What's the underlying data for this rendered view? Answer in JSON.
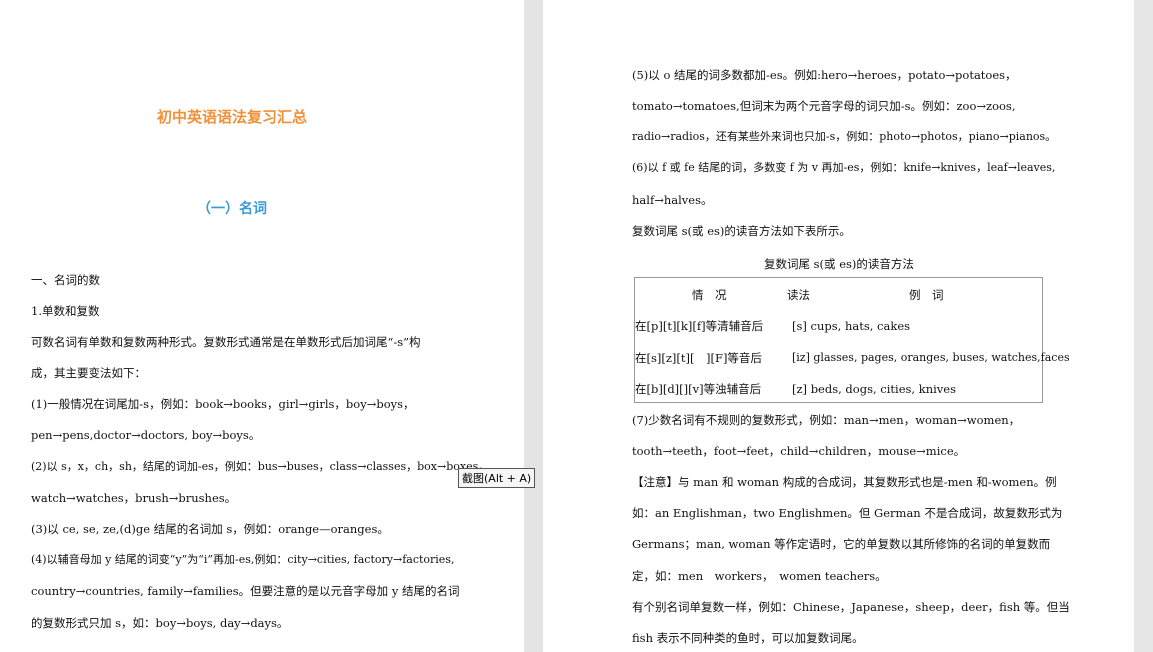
{
  "left_page": {
    "doc_title": "初中英语语法复习汇总",
    "section_title": "（一）名词",
    "lines": [
      "一、名词的数",
      "1.单数和复数",
      "可数名词有单数和复数两种形式。复数形式通常是在单数形式后加词尾“-s”构",
      "成，其主要变法如下：",
      "(1)一般情况在词尾加-s，例如：book→books，girl→girls，boy→boys，",
      "pen→pens,doctor→doctors, boy→boys。",
      "(2)以 s，x，ch，sh，结尾的词加-es，例如：bus→buses，class→classes，box→boxes，",
      "watch→watches，brush→brushes。",
      "(3)以 ce, se, ze,(d)ge 结尾的名词加 s，例如：orange—oranges。",
      "(4)以辅音母加 y 结尾的词变“y”为“i”再加-es,例如：city→cities, factory→factories,",
      "country→countries, family→families。但要注意的是以元音字母加 y 结尾的名词",
      "的复数形式只加 s，如：boy→boys, day→days。"
    ]
  },
  "right_page": {
    "lines_top": [
      "(5)以 o 结尾的词多数都加-es。例如:hero→heroes，potato→potatoes，",
      "tomato→tomatoes,但词末为两个元音字母的词只加-s。例如：zoo→zoos,",
      "radio→radios，还有某些外来词也只加-s，例如：photo→photos，piano→pianos。",
      "(6)以 f 或 fe 结尾的词，多数变 f 为 v 再加-es，例如：knife→knives，leaf→leaves,",
      "half→halves。",
      "复数词尾 s(或 es)的读音方法如下表所示。"
    ],
    "table_caption": "复数词尾 s(或 es)的读音方法",
    "table": {
      "headers": [
        "情　况",
        "读法",
        "例　词"
      ],
      "rows": [
        [
          "在[p][t][k][f]等清辅音后",
          "[s]  cups, hats, cakes"
        ],
        [
          "在[s][z][t][　][F]等音后",
          "[iz]  glasses, pages, oranges, buses, watches,faces"
        ],
        [
          "在[b][d][][v]等浊辅音后",
          "[z]  beds, dogs, cities, knives"
        ]
      ]
    },
    "lines_bottom": [
      "(7)少数名词有不规则的复数形式，例如：man→men，woman→women，",
      "tooth→teeth，foot→feet，child→children，mouse→mice。",
      "【注意】与 man 和 woman 构成的合成词，其复数形式也是-men 和-women。例",
      "如：an Englishman，two Englishmen。但 German 不是合成词，故复数形式为",
      "Germans；man, woman 等作定语时，它的单复数以其所修饰的名词的单复数而",
      "定，如：men　workers，　women teachers。",
      "有个别名词单复数一样，例如：Chinese，Japanese，sheep，deer，fish 等。但当",
      "fish 表示不同种类的鱼时，可以加复数词尾。"
    ]
  },
  "tooltip": "截图(Alt + A)"
}
